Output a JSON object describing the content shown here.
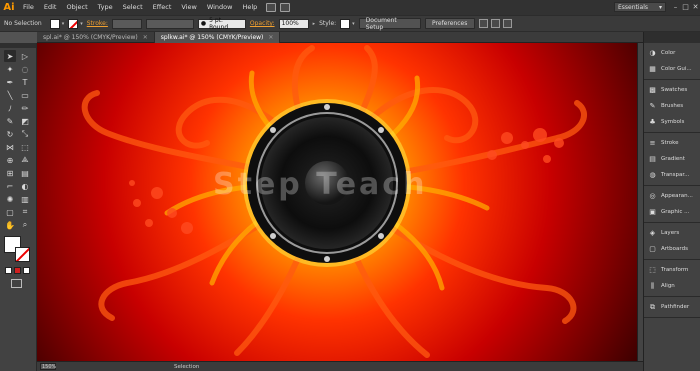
{
  "app": {
    "logo": "Ai",
    "menu": [
      "File",
      "Edit",
      "Object",
      "Type",
      "Select",
      "Effect",
      "View",
      "Window",
      "Help"
    ],
    "workspace": "Essentials"
  },
  "control_bar": {
    "selection_label": "No Selection",
    "stroke_label": "Stroke:",
    "brush_value": "5 pt. Round",
    "opacity_label": "Opacity:",
    "opacity_value": "100%",
    "style_label": "Style:",
    "document_setup": "Document Setup",
    "preferences": "Preferences"
  },
  "tabs": [
    {
      "label": "spl.ai* @ 150% (CMYK/Preview)",
      "active": false
    },
    {
      "label": "splkw.ai* @ 150% (CMYK/Preview)",
      "active": true
    }
  ],
  "artwork": {
    "watermark": "Step Teach"
  },
  "status_bar": {
    "zoom": "150%",
    "tool": "Selection"
  },
  "right_panels": [
    [
      {
        "icon": "color-icon",
        "label": "Color"
      },
      {
        "icon": "color-guide-icon",
        "label": "Color Gui..."
      }
    ],
    [
      {
        "icon": "swatches-icon",
        "label": "Swatches"
      },
      {
        "icon": "brushes-icon",
        "label": "Brushes"
      },
      {
        "icon": "symbols-icon",
        "label": "Symbols"
      }
    ],
    [
      {
        "icon": "stroke-icon",
        "label": "Stroke"
      },
      {
        "icon": "gradient-icon",
        "label": "Gradient"
      },
      {
        "icon": "transparency-icon",
        "label": "Transpar..."
      }
    ],
    [
      {
        "icon": "appearance-icon",
        "label": "Appearan..."
      },
      {
        "icon": "graphic-styles-icon",
        "label": "Graphic ..."
      }
    ],
    [
      {
        "icon": "layers-icon",
        "label": "Layers"
      },
      {
        "icon": "artboards-icon",
        "label": "Artboards"
      }
    ],
    [
      {
        "icon": "transform-icon",
        "label": "Transform"
      },
      {
        "icon": "align-icon",
        "label": "Align"
      }
    ],
    [
      {
        "icon": "pathfinder-icon",
        "label": "Pathfinder"
      }
    ]
  ],
  "colors": {
    "accent": "#ff9a00",
    "canvas_center": "#ffd200",
    "canvas_mid": "#ff3000",
    "canvas_edge": "#3a0000"
  }
}
